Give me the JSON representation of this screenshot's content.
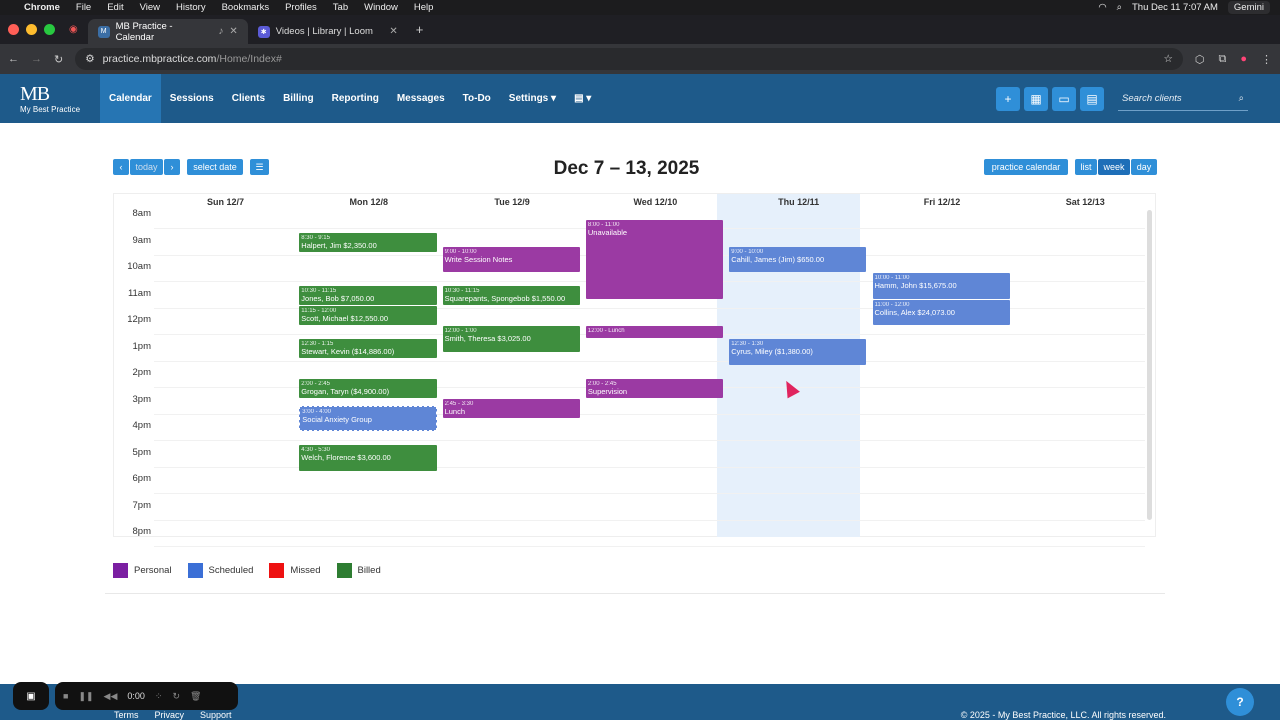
{
  "menubar": {
    "app": "Chrome",
    "items": [
      "File",
      "Edit",
      "View",
      "History",
      "Bookmarks",
      "Profiles",
      "Tab",
      "Window",
      "Help"
    ],
    "clock": "Thu Dec 11  7:07 AM",
    "gemini": "Gemini"
  },
  "tabs": [
    {
      "title": "MB Practice - Calendar",
      "active": true
    },
    {
      "title": "Videos | Library | Loom",
      "active": false
    }
  ],
  "address": {
    "host": "practice.mbpractice.com",
    "path": "/Home/Index#"
  },
  "app": {
    "logo_letters": "MB",
    "logo_tag": "My Best Practice",
    "nav": [
      "Calendar",
      "Sessions",
      "Clients",
      "Billing",
      "Reporting",
      "Messages",
      "To-Do",
      "Settings"
    ],
    "search_placeholder": "Search clients"
  },
  "toolbar": {
    "today": "today",
    "select_date": "select date",
    "practice_calendar": "practice calendar",
    "views": [
      "list",
      "week",
      "day"
    ],
    "title": "Dec 7 – 13, 2025"
  },
  "days": [
    "Sun 12/7",
    "Mon 12/8",
    "Tue 12/9",
    "Wed 12/10",
    "Thu 12/11",
    "Fri 12/12",
    "Sat 12/13"
  ],
  "hours": [
    "8am",
    "9am",
    "10am",
    "11am",
    "12pm",
    "1pm",
    "2pm",
    "3pm",
    "4pm",
    "5pm",
    "6pm",
    "7pm",
    "8pm"
  ],
  "events": [
    {
      "day": 1,
      "start": 8.5,
      "end": 9.25,
      "time": "8:30 - 9:15",
      "label": "Halpert, Jim $2,350.00",
      "status": "billed"
    },
    {
      "day": 1,
      "start": 10.5,
      "end": 11.25,
      "time": "10:30 - 11:15",
      "label": "Jones, Bob $7,050.00",
      "status": "billed"
    },
    {
      "day": 1,
      "start": 11.25,
      "end": 12,
      "time": "11:15 - 12:00",
      "label": "Scott, Michael $12,550.00",
      "status": "billed"
    },
    {
      "day": 1,
      "start": 12.5,
      "end": 13.25,
      "time": "12:30 - 1:15",
      "label": "Stewart, Kevin ($14,886.00)",
      "status": "billed"
    },
    {
      "day": 1,
      "start": 14,
      "end": 14.75,
      "time": "2:00 - 2:45",
      "label": "Grogan, Taryn ($4,900.00)",
      "status": "billed"
    },
    {
      "day": 1,
      "start": 15,
      "end": 16,
      "time": "3:00 - 4:00",
      "label": "Social Anxiety Group",
      "status": "scheduled",
      "dashed": true
    },
    {
      "day": 1,
      "start": 16.5,
      "end": 17.5,
      "time": "4:30 - 5:30",
      "label": "Welch, Florence $3,600.00",
      "status": "billed"
    },
    {
      "day": 2,
      "start": 9,
      "end": 10,
      "time": "9:00 - 10:00",
      "label": "Write Session Notes",
      "status": "personal"
    },
    {
      "day": 2,
      "start": 10.5,
      "end": 11.25,
      "time": "10:30 - 11:15",
      "label": "Squarepants, Spongebob $1,550.00",
      "status": "billed"
    },
    {
      "day": 2,
      "start": 12,
      "end": 13,
      "time": "12:00 - 1:00",
      "label": "Smith, Theresa $3,025.00",
      "status": "billed"
    },
    {
      "day": 2,
      "start": 14.75,
      "end": 15.5,
      "time": "2:45 - 3:30",
      "label": "Lunch",
      "status": "personal"
    },
    {
      "day": 3,
      "start": 8,
      "end": 11,
      "time": "8:00 - 11:00",
      "label": "Unavailable",
      "status": "personal"
    },
    {
      "day": 3,
      "start": 12,
      "end": 12.5,
      "time": "12:00 - Lunch",
      "label": "",
      "status": "personal"
    },
    {
      "day": 3,
      "start": 14,
      "end": 14.75,
      "time": "2:00 - 2:45",
      "label": "Supervision",
      "status": "personal"
    },
    {
      "day": 4,
      "start": 9,
      "end": 10,
      "time": "9:00 - 10:00",
      "label": "Cahill, James (Jim) $650.00",
      "status": "scheduled"
    },
    {
      "day": 4,
      "start": 12.5,
      "end": 13.5,
      "time": "12:30 - 1:30",
      "label": "Cyrus, Miley ($1,380.00)",
      "status": "scheduled"
    },
    {
      "day": 5,
      "start": 10,
      "end": 11,
      "time": "10:00 - 11:00",
      "label": "Hamm, John $15,675.00",
      "status": "scheduled"
    },
    {
      "day": 5,
      "start": 11,
      "end": 12,
      "time": "11:00 - 12:00",
      "label": "Collins, Alex $24,073.00",
      "status": "scheduled"
    }
  ],
  "legend": [
    {
      "label": "Personal",
      "color": "#7b1fa2"
    },
    {
      "label": "Scheduled",
      "color": "#3b6fd6"
    },
    {
      "label": "Missed",
      "color": "#ee1111"
    },
    {
      "label": "Billed",
      "color": "#2e7d32"
    }
  ],
  "footer": {
    "links": [
      "Terms",
      "Privacy",
      "Support"
    ],
    "copyright": "© 2025 - My Best Practice, LLC. All rights reserved.",
    "help": "?"
  },
  "recorder": {
    "time": "0:00"
  }
}
